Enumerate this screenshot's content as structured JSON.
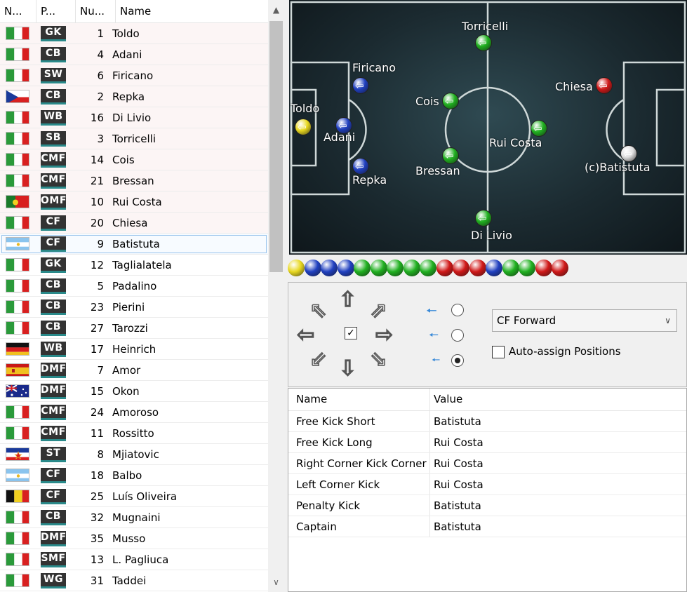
{
  "columns": {
    "nat": "N...",
    "pos": "P...",
    "num": "Nu...",
    "name": "Name"
  },
  "players": [
    {
      "flag": "italy",
      "pos": "GK",
      "num": "1",
      "name": "Toldo"
    },
    {
      "flag": "italy",
      "pos": "CB",
      "num": "4",
      "name": "Adani"
    },
    {
      "flag": "italy",
      "pos": "SW",
      "num": "6",
      "name": "Firicano"
    },
    {
      "flag": "czech",
      "pos": "CB",
      "num": "2",
      "name": "Repka"
    },
    {
      "flag": "italy",
      "pos": "WB",
      "num": "16",
      "name": "Di Livio"
    },
    {
      "flag": "italy",
      "pos": "SB",
      "num": "3",
      "name": "Torricelli"
    },
    {
      "flag": "italy",
      "pos": "CMF",
      "num": "14",
      "name": "Cois"
    },
    {
      "flag": "italy",
      "pos": "CMF",
      "num": "21",
      "name": "Bressan"
    },
    {
      "flag": "portugal",
      "pos": "OMF",
      "num": "10",
      "name": "Rui Costa"
    },
    {
      "flag": "italy",
      "pos": "CF",
      "num": "20",
      "name": "Chiesa"
    },
    {
      "flag": "argentina",
      "pos": "CF",
      "num": "9",
      "name": "Batistuta"
    },
    {
      "flag": "italy",
      "pos": "GK",
      "num": "12",
      "name": "Taglialatela"
    },
    {
      "flag": "italy",
      "pos": "CB",
      "num": "5",
      "name": "Padalino"
    },
    {
      "flag": "italy",
      "pos": "CB",
      "num": "23",
      "name": "Pierini"
    },
    {
      "flag": "italy",
      "pos": "CB",
      "num": "27",
      "name": "Tarozzi"
    },
    {
      "flag": "germany",
      "pos": "WB",
      "num": "17",
      "name": "Heinrich"
    },
    {
      "flag": "spain",
      "pos": "DMF",
      "num": "7",
      "name": "Amor"
    },
    {
      "flag": "australia",
      "pos": "DMF",
      "num": "15",
      "name": "Okon"
    },
    {
      "flag": "italy",
      "pos": "CMF",
      "num": "24",
      "name": "Amoroso"
    },
    {
      "flag": "italy",
      "pos": "CMF",
      "num": "11",
      "name": "Rossitto"
    },
    {
      "flag": "yugoslavia",
      "pos": "ST",
      "num": "8",
      "name": "Mjiatovic"
    },
    {
      "flag": "argentina",
      "pos": "CF",
      "num": "18",
      "name": "Balbo"
    },
    {
      "flag": "belgium",
      "pos": "CF",
      "num": "25",
      "name": "Luís Oliveira"
    },
    {
      "flag": "italy",
      "pos": "CB",
      "num": "32",
      "name": "Mugnaini"
    },
    {
      "flag": "italy",
      "pos": "DMF",
      "num": "35",
      "name": "Musso"
    },
    {
      "flag": "italy",
      "pos": "SMF",
      "num": "13",
      "name": "L. Pagliuca"
    },
    {
      "flag": "italy",
      "pos": "WG",
      "num": "31",
      "name": "Taddei"
    }
  ],
  "selected_player": "Batistuta",
  "pitch_players": [
    {
      "name": "Toldo",
      "color": "#e8d820"
    },
    {
      "name": "Adani",
      "color": "#2040c0"
    },
    {
      "name": "Firicano",
      "color": "#2040c0"
    },
    {
      "name": "Repka",
      "color": "#2040c0"
    },
    {
      "name": "Di Livio",
      "color": "#20b020"
    },
    {
      "name": "Torricelli",
      "color": "#20b020"
    },
    {
      "name": "Cois",
      "color": "#20b020"
    },
    {
      "name": "Bressan",
      "color": "#20b020"
    },
    {
      "name": "Rui Costa",
      "color": "#20b020"
    },
    {
      "name": "Chiesa",
      "color": "#d01818"
    },
    {
      "name": "(c)Batistuta",
      "color": "#e0e0e0"
    }
  ],
  "ball_colors": [
    "#e8d820",
    "#2040c0",
    "#2040c0",
    "#2040c0",
    "#20b020",
    "#20b020",
    "#20b020",
    "#20b020",
    "#20b020",
    "#d01818",
    "#d01818",
    "#d01818",
    "#2040c0",
    "#20b020",
    "#20b020",
    "#d01818",
    "#d01818"
  ],
  "controls": {
    "direction_icons": [
      "arrow-up-left",
      "arrow-up",
      "arrow-up-right",
      "arrow-left",
      "arrow-right",
      "arrow-down-left",
      "arrow-down",
      "arrow-down-right"
    ],
    "role_value": "CF Forward",
    "auto_assign_label": "Auto-assign Positions",
    "auto_assign_checked": false,
    "run_radio_selected": 3
  },
  "grid": {
    "headers": {
      "name": "Name",
      "value": "Value"
    },
    "rows": [
      {
        "name": "Free Kick Short",
        "value": "Batistuta"
      },
      {
        "name": "Free Kick Long",
        "value": "Rui Costa"
      },
      {
        "name": "Right Corner Kick Corner",
        "value": "Rui Costa"
      },
      {
        "name": "Left Corner Kick",
        "value": "Rui Costa"
      },
      {
        "name": "Penalty Kick",
        "value": "Batistuta"
      },
      {
        "name": "Captain",
        "value": "Batistuta"
      }
    ]
  }
}
